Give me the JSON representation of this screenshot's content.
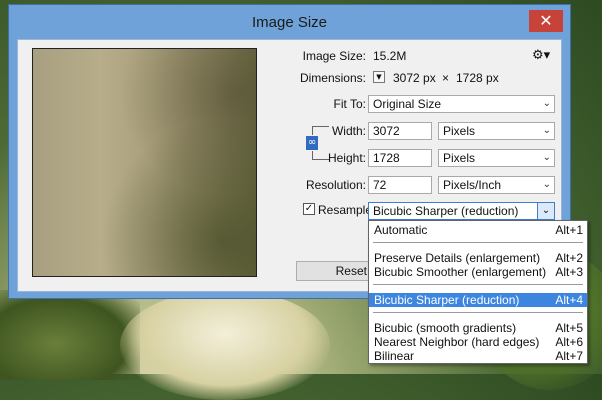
{
  "dialog": {
    "title": "Image Size",
    "close_icon": "close-icon"
  },
  "info": {
    "image_size_label": "Image Size:",
    "image_size_value": "15.2M",
    "dimensions_label": "Dimensions:",
    "dimensions_width": "3072 px",
    "dimensions_times": "×",
    "dimensions_height": "1728 px",
    "settings_icon": "gear-icon"
  },
  "fit_to": {
    "label": "Fit To:",
    "value": "Original Size"
  },
  "width": {
    "label": "Width:",
    "value": "3072",
    "unit": "Pixels"
  },
  "height": {
    "label": "Height:",
    "value": "1728",
    "unit": "Pixels"
  },
  "resolution": {
    "label": "Resolution:",
    "value": "72",
    "unit": "Pixels/Inch"
  },
  "resample": {
    "checkbox_mark": "✓",
    "label": "Resample:",
    "value": "Bicubic Sharper (reduction)",
    "checked": true
  },
  "buttons": {
    "reset_label": "Reset"
  },
  "dropdown_options": [
    {
      "name": "Automatic",
      "shortcut": "Alt+1"
    },
    {
      "name": "Preserve Details (enlargement)",
      "shortcut": "Alt+2"
    },
    {
      "name": "Bicubic Smoother (enlargement)",
      "shortcut": "Alt+3"
    },
    {
      "name": "Bicubic Sharper (reduction)",
      "shortcut": "Alt+4",
      "selected": true
    },
    {
      "name": "Bicubic (smooth gradients)",
      "shortcut": "Alt+5"
    },
    {
      "name": "Nearest Neighbor (hard edges)",
      "shortcut": "Alt+6"
    },
    {
      "name": "Bilinear",
      "shortcut": "Alt+7"
    }
  ]
}
